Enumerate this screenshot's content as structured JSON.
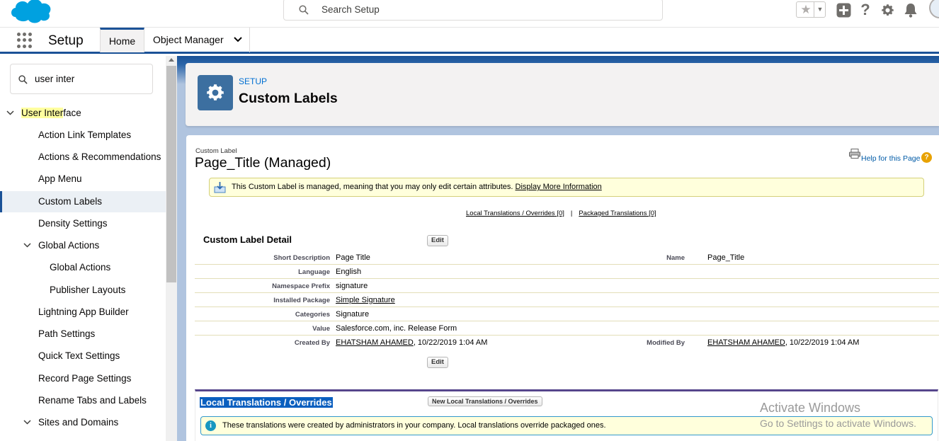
{
  "header": {
    "search_placeholder": "Search Setup",
    "icons": [
      "favorites-star-icon",
      "add-icon",
      "help-icon",
      "setup-gear-icon",
      "notifications-bell-icon"
    ]
  },
  "nav": {
    "app_name": "Setup",
    "tabs": [
      {
        "label": "Home",
        "active": true
      },
      {
        "label": "Object Manager",
        "active": false
      }
    ]
  },
  "sidebar": {
    "quickfind_value": "user inter",
    "items": [
      {
        "label_highlight": "User Inter",
        "label_rest": "face"
      },
      {
        "label": "Action Link Templates"
      },
      {
        "label": "Actions & Recommendations"
      },
      {
        "label": "App Menu"
      },
      {
        "label": "Custom Labels"
      },
      {
        "label": "Density Settings"
      },
      {
        "label": "Global Actions"
      },
      {
        "label": "Global Actions"
      },
      {
        "label": "Publisher Layouts"
      },
      {
        "label": "Lightning App Builder"
      },
      {
        "label": "Path Settings"
      },
      {
        "label": "Quick Text Settings"
      },
      {
        "label": "Record Page Settings"
      },
      {
        "label": "Rename Tabs and Labels"
      },
      {
        "label": "Sites and Domains"
      }
    ]
  },
  "page_header": {
    "eyebrow": "SETUP",
    "title": "Custom Labels"
  },
  "content": {
    "eyebrow": "Custom Label",
    "title": "Page_Title (Managed)",
    "help_link": "Help for this Page",
    "managed_msg": {
      "text": "This Custom Label is managed, meaning that you may only edit certain attributes. ",
      "link": "Display More Information"
    },
    "translation_links": {
      "local": "Local Translations / Overrides",
      "local_count": "[0]",
      "separator": "|",
      "packaged": "Packaged Translations",
      "packaged_count": "[0]"
    },
    "detail": {
      "section_title": "Custom Label Detail",
      "edit_label": "Edit",
      "rows": [
        {
          "label": "Short Description",
          "value": "Page Title",
          "label2": "Name",
          "value2": "Page_Title"
        },
        {
          "label": "Language",
          "value": "English"
        },
        {
          "label": "Namespace Prefix",
          "value": "signature"
        },
        {
          "label": "Installed Package",
          "value": "Simple Signature"
        },
        {
          "label": "Categories",
          "value": "Signature"
        },
        {
          "label": "Value",
          "value": "Salesforce.com, inc. Release Form"
        },
        {
          "label": "Created By",
          "value_link": "EHATSHAM AHAMED",
          "value": ", 10/22/2019 1:04 AM",
          "label2": "Modified By",
          "value2_link": "EHATSHAM AHAMED",
          "value2": ", 10/22/2019 1:04 AM"
        }
      ]
    },
    "local_translations": {
      "title": "Local Translations / Overrides",
      "new_button": "New Local Translations / Overrides",
      "info": "These translations were created by administrators in your company. Local translations override packaged ones."
    }
  },
  "watermark": {
    "line1": "Activate Windows",
    "line2": "Go to Settings to activate Windows."
  },
  "colors": {
    "brand_blue": "#1b5297",
    "link_blue": "#0070d2",
    "selected_bg": "#ebf0f5",
    "highlight": "#ffff9f",
    "message_bg": "#ffffdc"
  }
}
